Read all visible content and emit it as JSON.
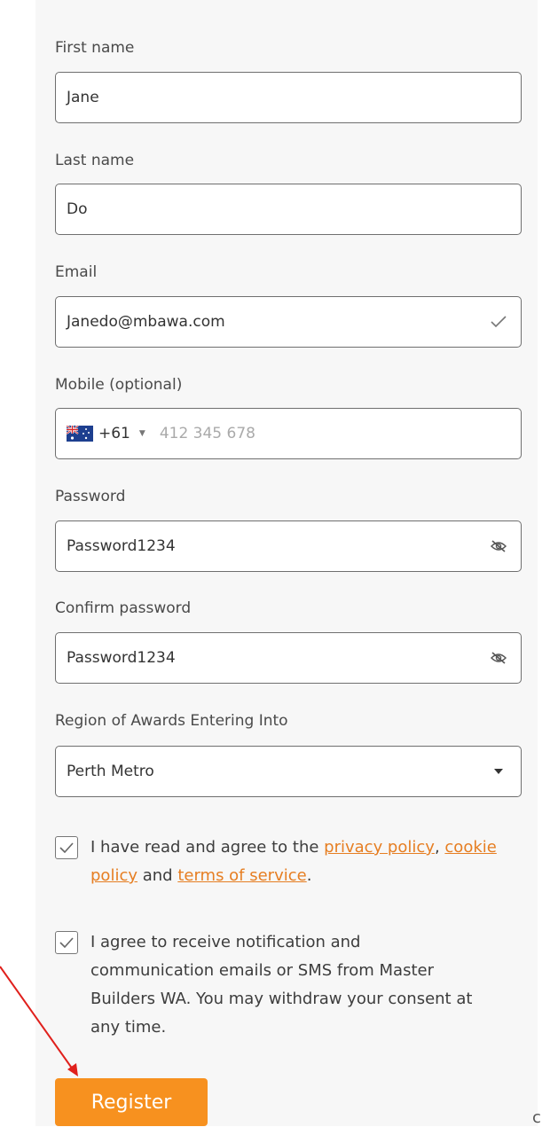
{
  "form": {
    "first_name": {
      "label": "First name",
      "value": "Jane"
    },
    "last_name": {
      "label": "Last name",
      "value": "Do"
    },
    "email": {
      "label": "Email",
      "value": "Janedo@mbawa.com"
    },
    "mobile": {
      "label": "Mobile (optional)",
      "country_code": "+61",
      "placeholder": "412 345 678"
    },
    "password": {
      "label": "Password",
      "value": "Password1234"
    },
    "confirm_password": {
      "label": "Confirm password",
      "value": "Password1234"
    },
    "region": {
      "label": "Region of Awards Entering Into",
      "selected": "Perth Metro"
    },
    "consent_terms": {
      "checked": true,
      "text_before": "I have read and agree to the ",
      "privacy_link": "privacy policy",
      "comma": ",",
      "cookie_link": "cookie policy",
      "and_text": " and ",
      "terms_link": "terms of service",
      "period": "."
    },
    "consent_notifications": {
      "checked": true,
      "text": "I agree to receive notification and communication emails or SMS from Master Builders WA. You may withdraw your consent at any time."
    },
    "register_label": "Register"
  },
  "edge_glyph": "c",
  "colors": {
    "accent": "#f7911f",
    "link": "#e67e22",
    "annotation_arrow": "#e0201c"
  },
  "icons": {
    "email_valid": "checkmark-icon",
    "password_toggle": "eye-slash-icon",
    "dropdown": "caret-down-icon",
    "country_flag": "australia-flag-icon"
  }
}
